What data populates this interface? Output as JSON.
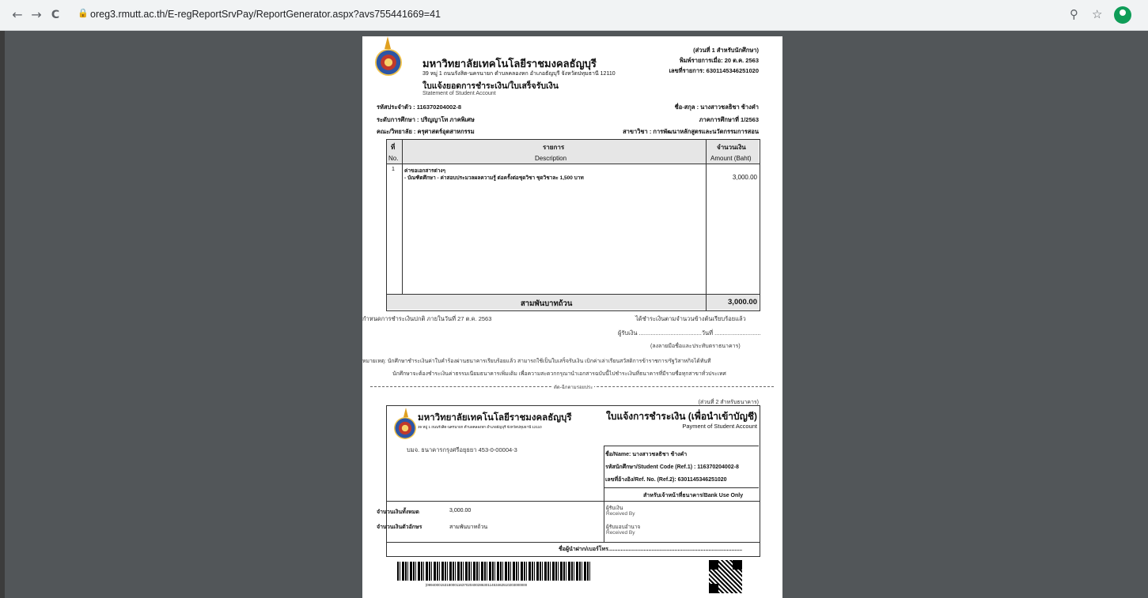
{
  "browser": {
    "url": "oreg3.rmutt.ac.th/E-regReportSrvPay/ReportGenerator.aspx?avs755441669=41",
    "back_icon": "←",
    "forward_icon": "→",
    "reload_icon": "C",
    "zoom_icon": "⚲",
    "star_icon": "☆"
  },
  "doc": {
    "part1_label": "(ส่วนที่ 1 สำหรับนักศึกษา)",
    "print_date": "พิมพ์รายการเมื่อ: 20 ต.ค. 2563",
    "transaction_no": "เลขที่รายการ: 6301145346251020",
    "university": "มหาวิทยาลัยเทคโนโลยีราชมงคลธัญบุรี",
    "address": "39 หมู่ 1 ถนนรังสิต-นครนายก ตำบลคลองหก อำเภอธัญบุรี จังหวัดปทุมธานี 12110",
    "title_th": "ใบแจ้งยอดการชำระเงิน/ใบเสร็จรับเงิน",
    "title_en": "Statement of Student Account",
    "student_id": "รหัสประจำตัว :    116370204002-8",
    "name": "ชื่อ-สกุล : นางสาวชลธิชา  ช้างคำ",
    "level": "ระดับการศึกษา :    ปริญญาโท ภาคพิเศษ",
    "term": "ภาคการศึกษาที่ 1/2563",
    "faculty": "คณะ/วิทยาลัย : ครุศาสตร์อุตสาหกรรม",
    "program": "สาขาวิชา : การพัฒนาหลักสูตรและนวัตกรรมการสอน",
    "col_no_th": "ที่",
    "col_no_en": "No.",
    "col_desc_th": "รายการ",
    "col_desc_en": "Description",
    "col_amt_th": "จำนวนเงิน",
    "col_amt_en": "Amount (Baht)",
    "items": [
      {
        "no": "1",
        "line1": "ค่าขอเอกสารต่างๆ",
        "line2": "- บัณฑิตศึกษา - ค่าสอบประมวลผลความรู้ ต่อครั้งต่อชุดวิชา ชุดวิชาละ 1,500 บาท",
        "amount": "3,000.00"
      }
    ],
    "total_text": "สามพันบาทถ้วน",
    "total_amount": "3,000.00",
    "deadline": "กำหนดการชำระเงินปกติ ภายในวันที่  27 ต.ค. 2563",
    "received_note": "ได้ชำระเงินตามจำนวนข้างต้นเรียบร้อยแล้ว",
    "receiver_line": "ผู้รับเงิน ......................................วันที่ ............................",
    "sign_note": "(ลงลายมือชื่อและประทับตราธนาคาร)",
    "remark1": "หมายเหตุ: นักศึกษาชำระเงินค่าใบคำร้องผ่านธนาคารเรียบร้อยแล้ว สามารถใช้เป็นใบเสร็จรับเงิน เบิกค่าเล่าเรียนสวัสดิการข้าราชการ/รัฐวิสาหกิจได้ทันที",
    "remark2": "นักศึกษาจะต้องชำระเงินค่าธรรมเนียมธนาคารเพิ่มเติม เพื่อความสะดวกกรุณานำเอกสารฉบับนี้ไปชำระเงินที่ธนาคารที่มีรายชื่อทุกสาขาทั่วประเทศ",
    "cut_here": "ตัด-ฉีกตามรอยประ",
    "part2_label": "(ส่วนที่ 2 สำหรับธนาคาร)",
    "bank_title_th": "ใบแจ้งการชำระเงิน (เพื่อนำเข้าบัญชี)",
    "bank_title_en": "Payment of Student Account",
    "bank_account": "บมจ. ธนาคารกรุงศรีอยุธยา 453-0-00004-3",
    "b_name": "ชื่อ/Name:  นางสาวชลธิชา  ช้างคำ",
    "b_code": "รหัสนักศึกษา/Student Code (Ref.1) : 116370204002-8",
    "b_ref": "เลขที่อ้างอิง/Ref. No. (Ref.2): 6301145346251020",
    "bank_use": "สำหรับเจ้าหน้าที่ธนาคาร/Bank Use Only",
    "amt_label": "จำนวนเงินทั้งหมด",
    "amt_value": "3,000.00",
    "amt_text_label": "จำนวนเงินตัวอักษร",
    "amt_text_value": "สามพันบาทถ้วน",
    "recv_th": "ผู้รับเงิน",
    "recv_en": "Received By",
    "auth_th": "ผู้รับมอบอำนาจ",
    "auth_en": "Received By",
    "payer": "ชื่อผู้นำฝาก/เบอร์โทร.......................................................................................",
    "barcode_text": "|099400015318000116370204002863011453462510203000000"
  }
}
